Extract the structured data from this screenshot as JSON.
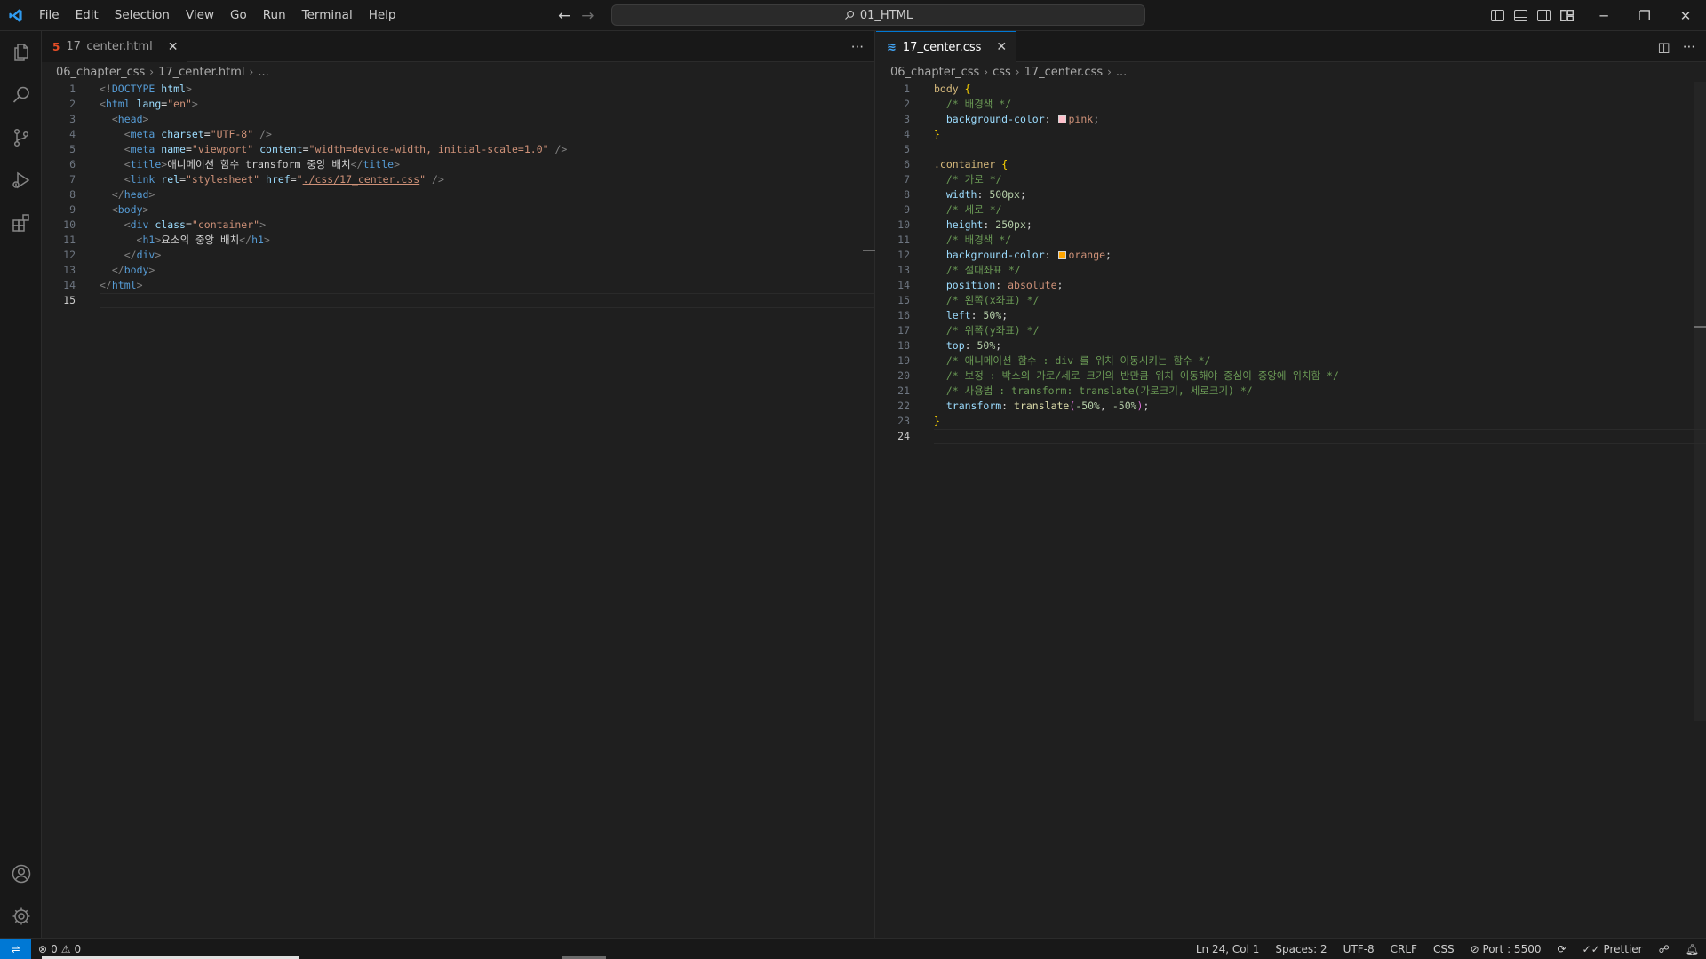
{
  "menu": [
    "File",
    "Edit",
    "Selection",
    "View",
    "Go",
    "Run",
    "Terminal",
    "Help"
  ],
  "search": {
    "label": "01_HTML"
  },
  "left_editor": {
    "tab": {
      "label": "17_center.html"
    },
    "breadcrumb": [
      "06_chapter_css",
      "17_center.html",
      "..."
    ],
    "lines": [
      [
        [
          "t-br",
          "<!"
        ],
        [
          "t-tag",
          "DOCTYPE"
        ],
        [
          "t-text",
          " "
        ],
        [
          "t-attr",
          "html"
        ],
        [
          "t-br",
          ">"
        ]
      ],
      [
        [
          "t-br",
          "<"
        ],
        [
          "t-tag",
          "html"
        ],
        [
          "t-text",
          " "
        ],
        [
          "t-attr",
          "lang"
        ],
        [
          "t-text",
          "="
        ],
        [
          "t-str",
          "\"en\""
        ],
        [
          "t-br",
          ">"
        ]
      ],
      [
        [
          "t-text",
          "  "
        ],
        [
          "t-br",
          "<"
        ],
        [
          "t-tag",
          "head"
        ],
        [
          "t-br",
          ">"
        ]
      ],
      [
        [
          "t-text",
          "    "
        ],
        [
          "t-br",
          "<"
        ],
        [
          "t-tag",
          "meta"
        ],
        [
          "t-text",
          " "
        ],
        [
          "t-attr",
          "charset"
        ],
        [
          "t-text",
          "="
        ],
        [
          "t-str",
          "\"UTF-8\""
        ],
        [
          "t-text",
          " "
        ],
        [
          "t-br",
          "/>"
        ]
      ],
      [
        [
          "t-text",
          "    "
        ],
        [
          "t-br",
          "<"
        ],
        [
          "t-tag",
          "meta"
        ],
        [
          "t-text",
          " "
        ],
        [
          "t-attr",
          "name"
        ],
        [
          "t-text",
          "="
        ],
        [
          "t-str",
          "\"viewport\""
        ],
        [
          "t-text",
          " "
        ],
        [
          "t-attr",
          "content"
        ],
        [
          "t-text",
          "="
        ],
        [
          "t-str",
          "\"width=device-width, initial-scale=1.0\""
        ],
        [
          "t-text",
          " "
        ],
        [
          "t-br",
          "/>"
        ]
      ],
      [
        [
          "t-text",
          "    "
        ],
        [
          "t-br",
          "<"
        ],
        [
          "t-tag",
          "title"
        ],
        [
          "t-br",
          ">"
        ],
        [
          "t-text",
          "애니메이션 함수 transform 중앙 배치"
        ],
        [
          "t-br",
          "</"
        ],
        [
          "t-tag",
          "title"
        ],
        [
          "t-br",
          ">"
        ]
      ],
      [
        [
          "t-text",
          "    "
        ],
        [
          "t-br",
          "<"
        ],
        [
          "t-tag",
          "link"
        ],
        [
          "t-text",
          " "
        ],
        [
          "t-attr",
          "rel"
        ],
        [
          "t-text",
          "="
        ],
        [
          "t-str",
          "\"stylesheet\""
        ],
        [
          "t-text",
          " "
        ],
        [
          "t-attr",
          "href"
        ],
        [
          "t-text",
          "="
        ],
        [
          "t-str",
          "\""
        ],
        [
          "t-link",
          "./css/17_center.css"
        ],
        [
          "t-str",
          "\""
        ],
        [
          "t-text",
          " "
        ],
        [
          "t-br",
          "/>"
        ]
      ],
      [
        [
          "t-text",
          "  "
        ],
        [
          "t-br",
          "</"
        ],
        [
          "t-tag",
          "head"
        ],
        [
          "t-br",
          ">"
        ]
      ],
      [
        [
          "t-text",
          "  "
        ],
        [
          "t-br",
          "<"
        ],
        [
          "t-tag",
          "body"
        ],
        [
          "t-br",
          ">"
        ]
      ],
      [
        [
          "t-text",
          "    "
        ],
        [
          "t-br",
          "<"
        ],
        [
          "t-tag",
          "div"
        ],
        [
          "t-text",
          " "
        ],
        [
          "t-attr",
          "class"
        ],
        [
          "t-text",
          "="
        ],
        [
          "t-str",
          "\"container\""
        ],
        [
          "t-br",
          ">"
        ]
      ],
      [
        [
          "t-text",
          "      "
        ],
        [
          "t-br",
          "<"
        ],
        [
          "t-tag",
          "h1"
        ],
        [
          "t-br",
          ">"
        ],
        [
          "t-text",
          "요소의 중앙 배치"
        ],
        [
          "t-br",
          "</"
        ],
        [
          "t-tag",
          "h1"
        ],
        [
          "t-br",
          ">"
        ]
      ],
      [
        [
          "t-text",
          "    "
        ],
        [
          "t-br",
          "</"
        ],
        [
          "t-tag",
          "div"
        ],
        [
          "t-br",
          ">"
        ]
      ],
      [
        [
          "t-text",
          "  "
        ],
        [
          "t-br",
          "</"
        ],
        [
          "t-tag",
          "body"
        ],
        [
          "t-br",
          ">"
        ]
      ],
      [
        [
          "t-br",
          "</"
        ],
        [
          "t-tag",
          "html"
        ],
        [
          "t-br",
          ">"
        ]
      ],
      []
    ],
    "current_line": 15
  },
  "right_editor": {
    "tab": {
      "label": "17_center.css"
    },
    "breadcrumb": [
      "06_chapter_css",
      "css",
      "17_center.css",
      "..."
    ],
    "lines": [
      [
        [
          "t-sel",
          "body"
        ],
        [
          "t-text",
          " "
        ],
        [
          "t-brace",
          "{"
        ]
      ],
      [
        [
          "t-text",
          "  "
        ],
        [
          "t-com",
          "/* 배경색 */"
        ]
      ],
      [
        [
          "t-text",
          "  "
        ],
        [
          "t-prop",
          "background-color"
        ],
        [
          "t-punc",
          ": "
        ],
        [
          "swatch",
          "#ffc0cb"
        ],
        [
          "t-val",
          "pink"
        ],
        [
          "t-punc",
          ";"
        ]
      ],
      [
        [
          "t-brace",
          "}"
        ]
      ],
      [],
      [
        [
          "t-sel",
          ".container"
        ],
        [
          "t-text",
          " "
        ],
        [
          "t-brace",
          "{"
        ]
      ],
      [
        [
          "t-text",
          "  "
        ],
        [
          "t-com",
          "/* 가로 */"
        ]
      ],
      [
        [
          "t-text",
          "  "
        ],
        [
          "t-prop",
          "width"
        ],
        [
          "t-punc",
          ": "
        ],
        [
          "t-num",
          "500px"
        ],
        [
          "t-punc",
          ";"
        ]
      ],
      [
        [
          "t-text",
          "  "
        ],
        [
          "t-com",
          "/* 세로 */"
        ]
      ],
      [
        [
          "t-text",
          "  "
        ],
        [
          "t-prop",
          "height"
        ],
        [
          "t-punc",
          ": "
        ],
        [
          "t-num",
          "250px"
        ],
        [
          "t-punc",
          ";"
        ]
      ],
      [
        [
          "t-text",
          "  "
        ],
        [
          "t-com",
          "/* 배경색 */"
        ]
      ],
      [
        [
          "t-text",
          "  "
        ],
        [
          "t-prop",
          "background-color"
        ],
        [
          "t-punc",
          ": "
        ],
        [
          "swatch",
          "#ffa500"
        ],
        [
          "t-val",
          "orange"
        ],
        [
          "t-punc",
          ";"
        ]
      ],
      [
        [
          "t-text",
          "  "
        ],
        [
          "t-com",
          "/* 절대좌표 */"
        ]
      ],
      [
        [
          "t-text",
          "  "
        ],
        [
          "t-prop",
          "position"
        ],
        [
          "t-punc",
          ": "
        ],
        [
          "t-val",
          "absolute"
        ],
        [
          "t-punc",
          ";"
        ]
      ],
      [
        [
          "t-text",
          "  "
        ],
        [
          "t-com",
          "/* 왼쪽(x좌표) */"
        ]
      ],
      [
        [
          "t-text",
          "  "
        ],
        [
          "t-prop",
          "left"
        ],
        [
          "t-punc",
          ": "
        ],
        [
          "t-num",
          "50%"
        ],
        [
          "t-punc",
          ";"
        ]
      ],
      [
        [
          "t-text",
          "  "
        ],
        [
          "t-com",
          "/* 위쪽(y좌표) */"
        ]
      ],
      [
        [
          "t-text",
          "  "
        ],
        [
          "t-prop",
          "top"
        ],
        [
          "t-punc",
          ": "
        ],
        [
          "t-num",
          "50%"
        ],
        [
          "t-punc",
          ";"
        ]
      ],
      [
        [
          "t-text",
          "  "
        ],
        [
          "t-com",
          "/* 애니메이션 함수 : div 를 위치 이동시키는 함수 */"
        ]
      ],
      [
        [
          "t-text",
          "  "
        ],
        [
          "t-com",
          "/* 보정 : 박스의 가로/세로 크기의 반만큼 위치 이동해야 중심이 중앙에 위치함 */"
        ]
      ],
      [
        [
          "t-text",
          "  "
        ],
        [
          "t-com",
          "/* 사용법 : transform: translate(가로크기, 세로크기) */"
        ]
      ],
      [
        [
          "t-text",
          "  "
        ],
        [
          "t-prop",
          "transform"
        ],
        [
          "t-punc",
          ": "
        ],
        [
          "t-func",
          "translate"
        ],
        [
          "t-paren",
          "("
        ],
        [
          "t-num",
          "-50%"
        ],
        [
          "t-punc",
          ", "
        ],
        [
          "t-num",
          "-50%"
        ],
        [
          "t-paren",
          ")"
        ],
        [
          "t-punc",
          ";"
        ]
      ],
      [
        [
          "t-brace",
          "}"
        ]
      ],
      []
    ],
    "current_line": 24
  },
  "status": {
    "errors": "0",
    "warnings": "0",
    "position": "Ln 24, Col 1",
    "spaces": "Spaces: 2",
    "encoding": "UTF-8",
    "eol": "CRLF",
    "language": "CSS",
    "port": "Port : 5500",
    "prettier": "Prettier"
  },
  "colors": {
    "accent": "#0078d4",
    "background": "#1f1f1f",
    "chrome": "#181818"
  }
}
